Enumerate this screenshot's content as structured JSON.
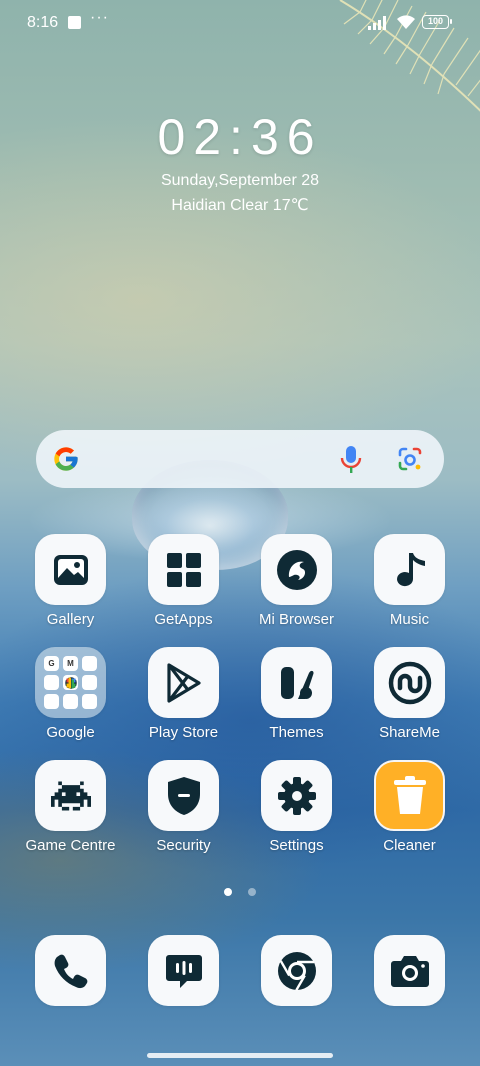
{
  "status_bar": {
    "time": "8:16",
    "more": "···",
    "battery": "100"
  },
  "clock": {
    "time": "02:36",
    "date": "Sunday,September 28",
    "weather": "Haidian Clear 17℃"
  },
  "search": {
    "provider_icon": "google-g-icon",
    "voice_icon": "mic-icon",
    "lens_icon": "google-lens-icon"
  },
  "apps": [
    {
      "label": "Gallery",
      "icon": "gallery-icon"
    },
    {
      "label": "GetApps",
      "icon": "getapps-icon"
    },
    {
      "label": "Mi Browser",
      "icon": "mi-browser-icon"
    },
    {
      "label": "Music",
      "icon": "music-note-icon"
    },
    {
      "label": "Google",
      "icon": "folder-icon"
    },
    {
      "label": "Play Store",
      "icon": "play-store-icon"
    },
    {
      "label": "Themes",
      "icon": "themes-icon"
    },
    {
      "label": "ShareMe",
      "icon": "shareme-icon"
    },
    {
      "label": "Game Centre",
      "icon": "game-invader-icon"
    },
    {
      "label": "Security",
      "icon": "shield-icon"
    },
    {
      "label": "Settings",
      "icon": "gear-icon"
    },
    {
      "label": "Cleaner",
      "icon": "trash-icon"
    }
  ],
  "folder_contents": [
    "G",
    "M",
    "",
    "",
    "",
    "",
    "",
    "",
    ""
  ],
  "dock": [
    {
      "icon": "phone-icon"
    },
    {
      "icon": "messages-icon"
    },
    {
      "icon": "chrome-icon"
    },
    {
      "icon": "camera-icon"
    }
  ],
  "page_indicator": {
    "pages": 2,
    "current": 1
  },
  "colors": {
    "icon_dark": "#0f2a35",
    "cleaner_accent": "#ffb026",
    "tile_bg": "#f7f9fb"
  }
}
